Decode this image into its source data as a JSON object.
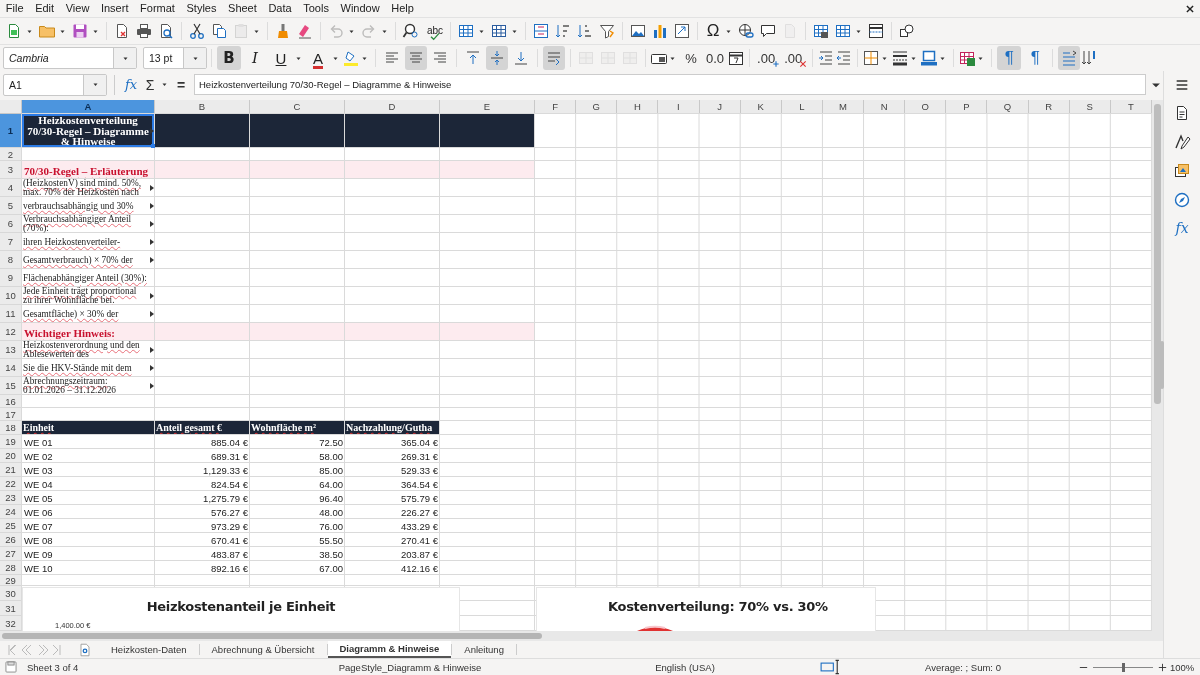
{
  "menu": [
    "File",
    "Edit",
    "View",
    "Insert",
    "Format",
    "Styles",
    "Sheet",
    "Data",
    "Tools",
    "Window",
    "Help"
  ],
  "standard_toolbar": {
    "spelling_glyph": "abc",
    "special_character_glyph": "Ω",
    "paste_enabled": false,
    "undo_enabled": false,
    "redo_enabled": false,
    "header_footer_enabled": false
  },
  "formatting_toolbar": {
    "font_name": "Cambria",
    "font_size": "13 pt",
    "bold_glyph": "B",
    "italic_glyph": "I",
    "underline_glyph": "U",
    "font_color_glyph": "A",
    "bold": true,
    "italic": false,
    "underline": false,
    "align_left": false,
    "align_center": true,
    "align_right": false,
    "align_top": false,
    "align_middle": true,
    "align_bottom": false,
    "wrap_text": true,
    "merge_enabled": false,
    "percent_glyph": "%",
    "standard_glyph": "0.0",
    "add_decimal_glyph": ".00",
    "delete_decimal_glyph": ".00",
    "ltr_glyph": "¶",
    "rtl_glyph": "¶",
    "paragraph_ltr": true,
    "paragraph_rtl": false,
    "text_direction_ltr": true
  },
  "formula_bar": {
    "cell_reference": "A1",
    "wizard_glyph": "fx",
    "sum_glyph": "Σ",
    "equals_glyph": "=",
    "content": "Heizkostenverteilung 70/30-Regel – Diagramme & Hinweise"
  },
  "columns": [
    {
      "label": "A",
      "selected": true
    },
    {
      "label": "B",
      "selected": false
    },
    {
      "label": "C",
      "selected": false
    },
    {
      "label": "D",
      "selected": false
    },
    {
      "label": "E",
      "selected": false
    },
    {
      "label": "F",
      "selected": false
    },
    {
      "label": "G",
      "selected": false
    },
    {
      "label": "H",
      "selected": false
    },
    {
      "label": "I",
      "selected": false
    },
    {
      "label": "J",
      "selected": false
    },
    {
      "label": "K",
      "selected": false
    },
    {
      "label": "L",
      "selected": false
    },
    {
      "label": "M",
      "selected": false
    },
    {
      "label": "N",
      "selected": false
    },
    {
      "label": "O",
      "selected": false
    },
    {
      "label": "P",
      "selected": false
    },
    {
      "label": "Q",
      "selected": false
    },
    {
      "label": "R",
      "selected": false
    },
    {
      "label": "S",
      "selected": false
    },
    {
      "label": "T",
      "selected": false
    }
  ],
  "rows": [
    {
      "number": "1",
      "selected": true,
      "kind": "title",
      "text": "Heizkostenverteilung 70/30-Regel – Diagramme & Hinweise",
      "overflow": true
    },
    {
      "number": "2",
      "selected": false,
      "kind": "empty"
    },
    {
      "number": "3",
      "selected": false,
      "kind": "section",
      "text": "70/30-Regel – Erläuterung",
      "overflow": false
    },
    {
      "number": "4",
      "selected": false,
      "kind": "note",
      "text": "(HeizkostenV) sind mind. 50%, max. 70% der Heizkosten nach",
      "overflow": true
    },
    {
      "number": "5",
      "selected": false,
      "kind": "note",
      "text": "verbrauchsabhängig und 30%",
      "overflow": true
    },
    {
      "number": "6",
      "selected": false,
      "kind": "note",
      "text": "Verbrauchsabhängiger Anteil (70%):",
      "overflow": true
    },
    {
      "number": "7",
      "selected": false,
      "kind": "note",
      "text": "ihren Heizkostenverteiler-",
      "overflow": true
    },
    {
      "number": "8",
      "selected": false,
      "kind": "note",
      "text": "Gesamtverbrauch) × 70% der",
      "overflow": true
    },
    {
      "number": "9",
      "selected": false,
      "kind": "note",
      "text": "Flächenabhängiger Anteil (30%):",
      "overflow": false
    },
    {
      "number": "10",
      "selected": false,
      "kind": "note",
      "text": "Jede Einheit trägt proportional zu ihrer Wohnfläche bei.",
      "overflow": true
    },
    {
      "number": "11",
      "selected": false,
      "kind": "note",
      "text": "Gesamtfläche) × 30% der",
      "overflow": true
    },
    {
      "number": "12",
      "selected": false,
      "kind": "section",
      "text": "Wichtiger Hinweis:",
      "overflow": false
    },
    {
      "number": "13",
      "selected": false,
      "kind": "note",
      "text": "Heizkostenverordnung und den Ablesewerten des",
      "overflow": true
    },
    {
      "number": "14",
      "selected": false,
      "kind": "note",
      "text": "Sie die HKV-Stände mit dem",
      "overflow": true
    },
    {
      "number": "15",
      "selected": false,
      "kind": "note",
      "text": "Abrechnungszeitraum: 01.01.2026 – 31.12.2026",
      "overflow": true
    },
    {
      "number": "16",
      "selected": false,
      "kind": "empty"
    },
    {
      "number": "17",
      "selected": false,
      "kind": "empty"
    },
    {
      "number": "18",
      "selected": false,
      "kind": "table_header",
      "cells": [
        "Einheit",
        "Anteil gesamt €",
        "Wohnfläche m²",
        "Nachzahlung/Gutha"
      ]
    },
    {
      "number": "19",
      "selected": false,
      "kind": "table_row",
      "cells": [
        "WE 01",
        "885.04 €",
        "72.50",
        "365.04 €"
      ]
    },
    {
      "number": "20",
      "selected": false,
      "kind": "table_row",
      "cells": [
        "WE 02",
        "689.31 €",
        "58.00",
        "269.31 €"
      ]
    },
    {
      "number": "21",
      "selected": false,
      "kind": "table_row",
      "cells": [
        "WE 03",
        "1,129.33 €",
        "85.00",
        "529.33 €"
      ]
    },
    {
      "number": "22",
      "selected": false,
      "kind": "table_row",
      "cells": [
        "WE 04",
        "824.54 €",
        "64.00",
        "364.54 €"
      ]
    },
    {
      "number": "23",
      "selected": false,
      "kind": "table_row",
      "cells": [
        "WE 05",
        "1,275.79 €",
        "96.40",
        "575.79 €"
      ]
    },
    {
      "number": "24",
      "selected": false,
      "kind": "table_row",
      "cells": [
        "WE 06",
        "576.27 €",
        "48.00",
        "226.27 €"
      ]
    },
    {
      "number": "25",
      "selected": false,
      "kind": "table_row",
      "cells": [
        "WE 07",
        "973.29 €",
        "76.00",
        "433.29 €"
      ]
    },
    {
      "number": "26",
      "selected": false,
      "kind": "table_row",
      "cells": [
        "WE 08",
        "670.41 €",
        "55.50",
        "270.41 €"
      ]
    },
    {
      "number": "27",
      "selected": false,
      "kind": "table_row",
      "cells": [
        "WE 09",
        "483.87 €",
        "38.50",
        "203.87 €"
      ]
    },
    {
      "number": "28",
      "selected": false,
      "kind": "table_row",
      "cells": [
        "WE 10",
        "892.16 €",
        "67.00",
        "412.16 €"
      ]
    },
    {
      "number": "29",
      "selected": false,
      "kind": "empty"
    },
    {
      "number": "30",
      "selected": false,
      "kind": "empty"
    },
    {
      "number": "31",
      "selected": false,
      "kind": "empty"
    },
    {
      "number": "32",
      "selected": false,
      "kind": "empty"
    }
  ],
  "charts": [
    {
      "title": "Heizkostenanteil je Einheit",
      "axis_label": "1,400.00 €"
    },
    {
      "title": "Kostenverteilung: 70% vs. 30%"
    }
  ],
  "sheet_tabs": [
    {
      "label": "Heizkosten-Daten",
      "selected": false
    },
    {
      "label": "Abrechnung & Übersicht",
      "selected": false
    },
    {
      "label": "Diagramm & Hinweise",
      "selected": true
    },
    {
      "label": "Anleitung",
      "selected": false
    }
  ],
  "sidebar": {
    "functions_glyph": "fx"
  },
  "status_bar": {
    "sheet": "Sheet 3 of 4",
    "page_style": "PageStyle_Diagramm & Hinweise",
    "language": "English (USA)",
    "summary": "Average: ; Sum: 0",
    "zoom_slider": {
      "level": 0.5
    },
    "zoom": "100%"
  }
}
